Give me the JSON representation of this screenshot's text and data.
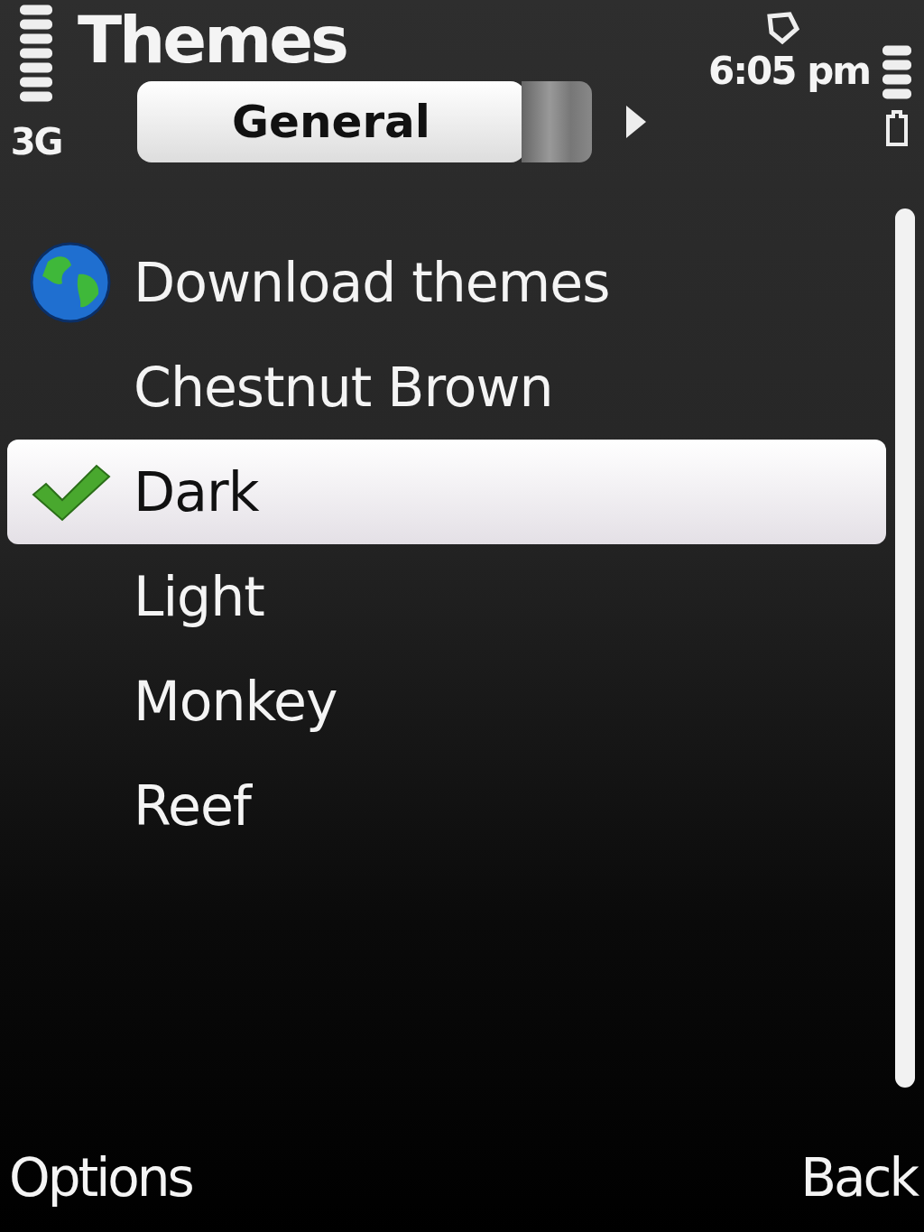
{
  "status_bar": {
    "network": "3G",
    "time": "6:05 pm"
  },
  "title": "Themes",
  "tabs": [
    {
      "label": "General",
      "selected": true
    }
  ],
  "items": [
    {
      "label": "Download themes",
      "kind": "link",
      "selected": false,
      "active": false
    },
    {
      "label": "Chestnut Brown",
      "kind": "theme",
      "selected": false,
      "active": false
    },
    {
      "label": "Dark",
      "kind": "theme",
      "selected": true,
      "active": true
    },
    {
      "label": "Light",
      "kind": "theme",
      "selected": false,
      "active": false
    },
    {
      "label": "Monkey",
      "kind": "theme",
      "selected": false,
      "active": false
    },
    {
      "label": "Reef",
      "kind": "theme",
      "selected": false,
      "active": false
    }
  ],
  "softkeys": {
    "left": "Options",
    "right": "Back"
  }
}
